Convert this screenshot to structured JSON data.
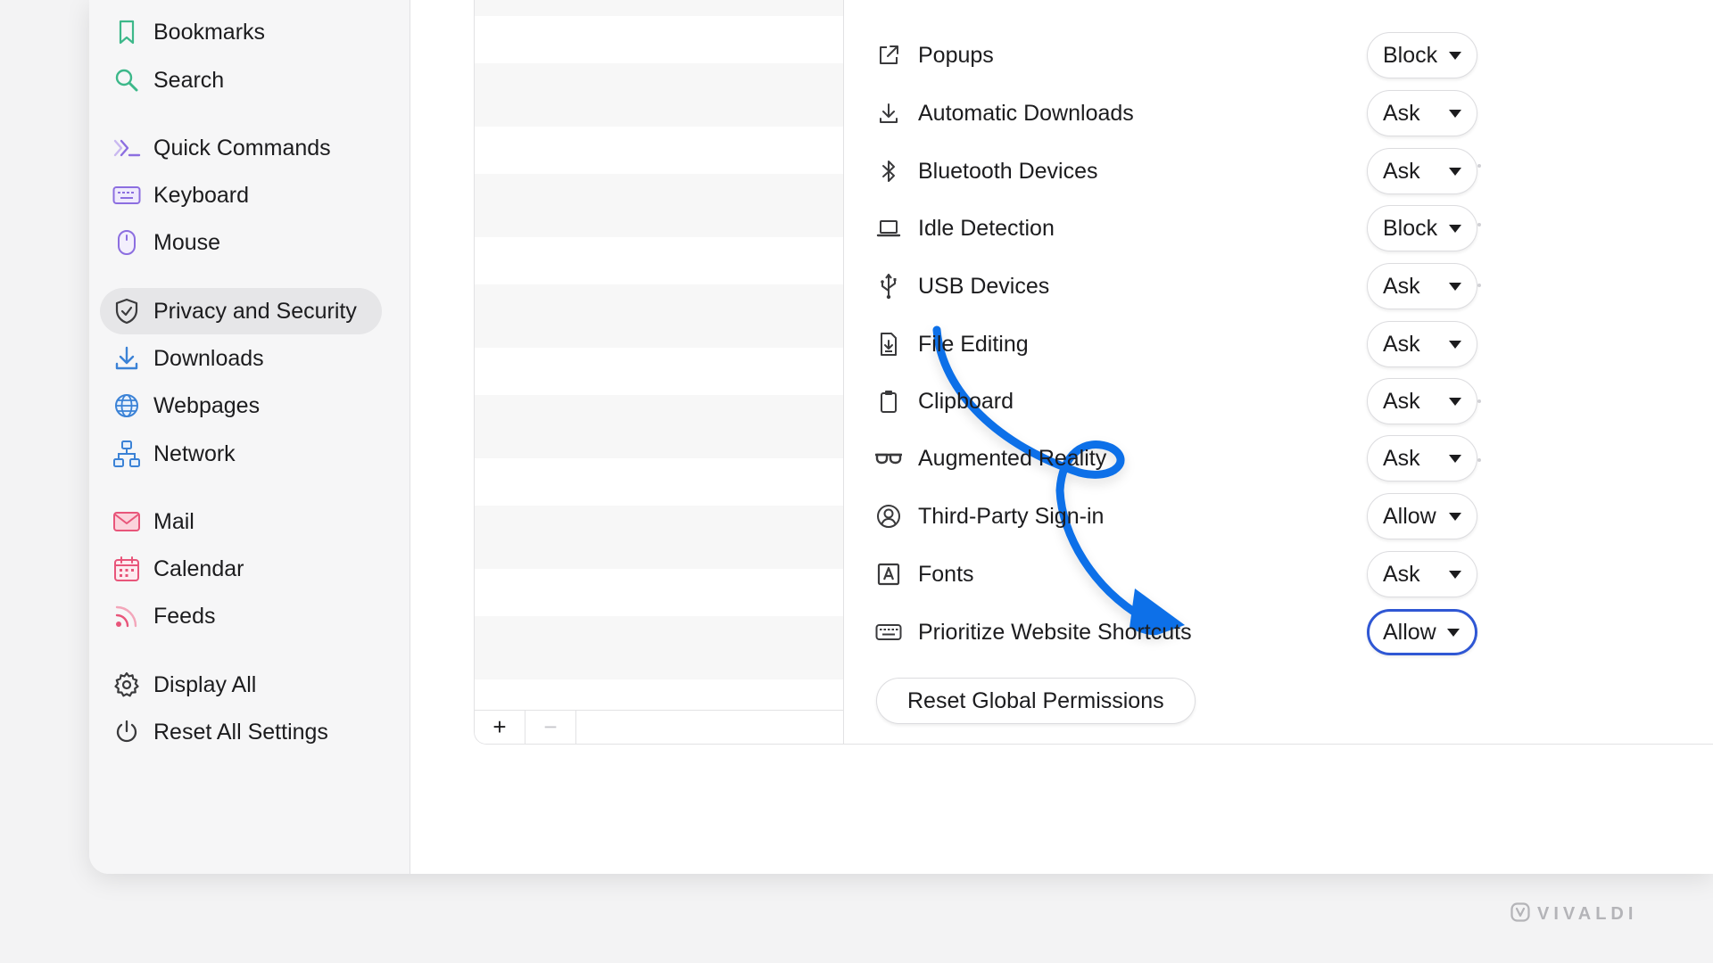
{
  "sidebar": {
    "items": [
      {
        "label": "Bookmarks",
        "icon": "bookmark-icon"
      },
      {
        "label": "Search",
        "icon": "search-icon"
      },
      {
        "label": "Quick Commands",
        "icon": "quick-commands-icon"
      },
      {
        "label": "Keyboard",
        "icon": "keyboard-icon"
      },
      {
        "label": "Mouse",
        "icon": "mouse-icon"
      },
      {
        "label": "Privacy and Security",
        "icon": "shield-icon",
        "active": true
      },
      {
        "label": "Downloads",
        "icon": "download-icon"
      },
      {
        "label": "Webpages",
        "icon": "globe-icon"
      },
      {
        "label": "Network",
        "icon": "network-icon"
      },
      {
        "label": "Mail",
        "icon": "mail-icon"
      },
      {
        "label": "Calendar",
        "icon": "calendar-icon"
      },
      {
        "label": "Feeds",
        "icon": "feed-icon"
      },
      {
        "label": "Display All",
        "icon": "gear-icon"
      },
      {
        "label": "Reset All Settings",
        "icon": "power-icon"
      }
    ]
  },
  "site_list": {
    "add_label": "+",
    "remove_label": "−"
  },
  "permissions": {
    "rows": [
      {
        "label": "Popups",
        "value": "Block",
        "icon": "external-link-icon"
      },
      {
        "label": "Automatic Downloads",
        "value": "Ask",
        "icon": "download-icon"
      },
      {
        "label": "Bluetooth Devices",
        "value": "Ask",
        "icon": "bluetooth-icon"
      },
      {
        "label": "Idle Detection",
        "value": "Block",
        "icon": "laptop-icon"
      },
      {
        "label": "USB Devices",
        "value": "Ask",
        "icon": "usb-icon"
      },
      {
        "label": "File Editing",
        "value": "Ask",
        "icon": "file-edit-icon"
      },
      {
        "label": "Clipboard",
        "value": "Ask",
        "icon": "clipboard-icon"
      },
      {
        "label": "Augmented Reality",
        "value": "Ask",
        "icon": "ar-glasses-icon"
      },
      {
        "label": "Third-Party Sign-in",
        "value": "Allow",
        "icon": "user-circle-icon"
      },
      {
        "label": "Fonts",
        "value": "Ask",
        "icon": "font-icon"
      },
      {
        "label": "Prioritize Website Shortcuts",
        "value": "Allow",
        "icon": "keyboard-icon",
        "focused": true
      }
    ],
    "reset_label": "Reset Global Permissions"
  },
  "colors": {
    "accent_focus": "#2f57d4",
    "annotation_arrow": "#0a6fe8"
  },
  "brand": {
    "text": "VIVALDI",
    "icon": "vivaldi-logo-icon"
  }
}
